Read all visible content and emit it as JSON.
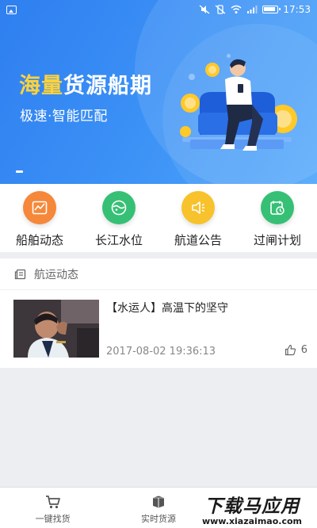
{
  "status_bar": {
    "time": "17:53"
  },
  "banner": {
    "title_accent": "海量",
    "title_rest": "货源船期",
    "subtitle": "极速·智能匹配"
  },
  "quick_menu": [
    {
      "label": "船舶动态",
      "icon": "chart-icon",
      "color": "#f5883a"
    },
    {
      "label": "长江水位",
      "icon": "water-level-icon",
      "color": "#36c075"
    },
    {
      "label": "航道公告",
      "icon": "megaphone-icon",
      "color": "#f7c22c"
    },
    {
      "label": "过闸计划",
      "icon": "schedule-icon",
      "color": "#36c075"
    }
  ],
  "news": {
    "header": "航运动态",
    "items": [
      {
        "title": "【水运人】高温下的坚守",
        "date": "2017-08-02 19:36:13",
        "likes": "6"
      }
    ]
  },
  "bottom_nav": [
    {
      "label": "一键找货",
      "icon": "cart-icon"
    },
    {
      "label": "实时货源",
      "icon": "box-icon"
    },
    {
      "label": "",
      "icon": ""
    }
  ],
  "watermark": {
    "text": "下载马应用",
    "url": "www.xiazaimao.com"
  },
  "colors": {
    "primary": "#3a87f0",
    "accent": "#ffd23c"
  }
}
